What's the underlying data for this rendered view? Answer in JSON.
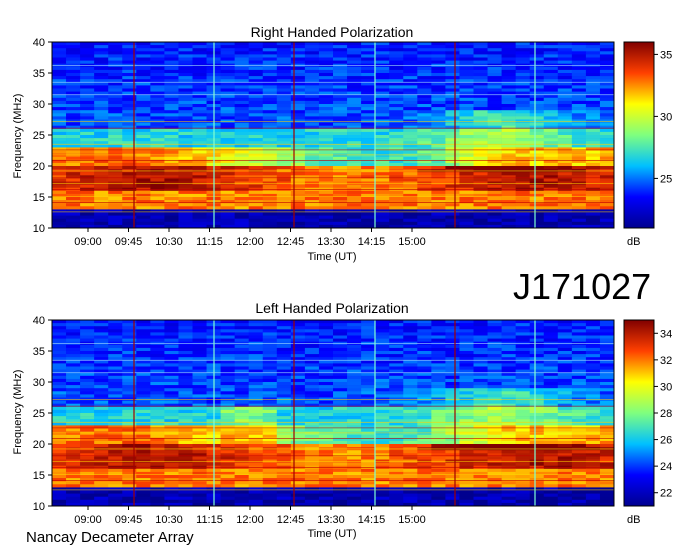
{
  "chart_data": [
    {
      "type": "heatmap",
      "title": "Right Handed Polarization",
      "xlabel": "Time (UT)",
      "ylabel": "Frequency (MHz)",
      "x_ticks": [
        "09:00",
        "09:45",
        "10:30",
        "11:15",
        "12:00",
        "12:45",
        "13:30",
        "14:15",
        "15:00"
      ],
      "y_ticks": [
        "40",
        "35",
        "30",
        "25",
        "20",
        "15",
        "10"
      ],
      "ylim": [
        10,
        40
      ],
      "colorbar": {
        "unit": "dB",
        "ticks": [
          "35",
          "30",
          "25"
        ],
        "range": [
          21,
          36
        ]
      },
      "colormap": [
        "#00008f",
        "#0000ff",
        "#00c0ff",
        "#7fff7f",
        "#ffff00",
        "#ff4000",
        "#800000"
      ]
    },
    {
      "type": "heatmap",
      "title": "Left Handed Polarization",
      "xlabel": "Time (UT)",
      "ylabel": "Frequency (MHz)",
      "x_ticks": [
        "09:00",
        "09:45",
        "10:30",
        "11:15",
        "12:00",
        "12:45",
        "13:30",
        "14:15",
        "15:00"
      ],
      "y_ticks": [
        "40",
        "35",
        "30",
        "25",
        "20",
        "15",
        "10"
      ],
      "ylim": [
        10,
        40
      ],
      "colorbar": {
        "unit": "dB",
        "ticks": [
          "34",
          "32",
          "30",
          "28",
          "26",
          "24",
          "22"
        ],
        "range": [
          21,
          35
        ]
      },
      "colormap": [
        "#00008f",
        "#0000ff",
        "#00c0ff",
        "#7fff7f",
        "#ffff00",
        "#ff4000",
        "#800000"
      ]
    }
  ],
  "observation_id": "J171027",
  "footer": "Nancay Decameter Array"
}
